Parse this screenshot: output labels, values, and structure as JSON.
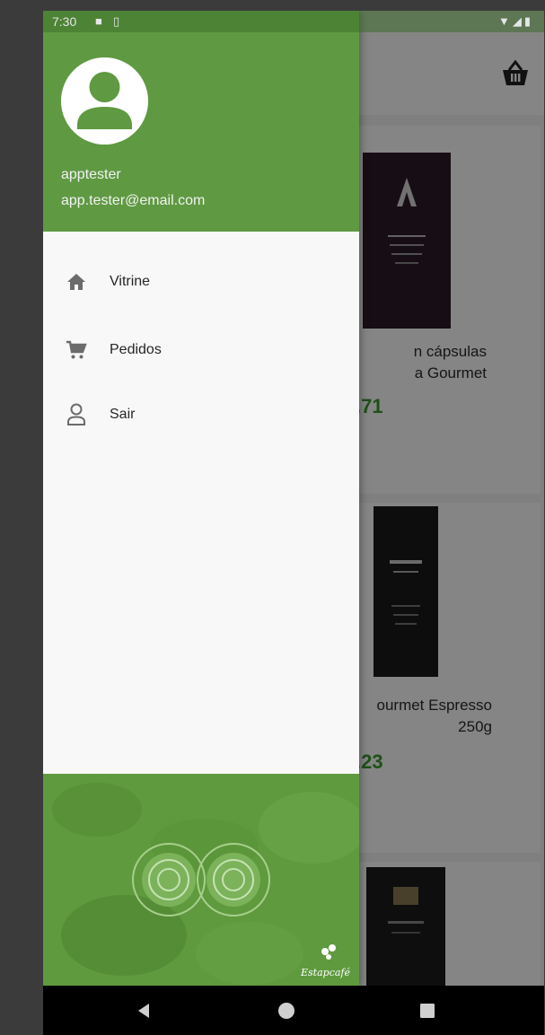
{
  "status_bar": {
    "time": "7:30",
    "icons": [
      "notification-icon",
      "sim-icon",
      "wifi-icon",
      "signal-icon",
      "battery-icon"
    ]
  },
  "drawer": {
    "header": {
      "username": "apptester",
      "email": "app.tester@email.com"
    },
    "menu": [
      {
        "label": "Vitrine",
        "icon": "home-icon"
      },
      {
        "label": "Pedidos",
        "icon": "cart-icon"
      },
      {
        "label": "Sair",
        "icon": "person-icon"
      }
    ],
    "footer": {
      "brand": "Estapcafé"
    }
  },
  "background": {
    "products": [
      {
        "name_line1": "n cápsulas",
        "name_line2": "a Gourmet",
        "price": ".71"
      },
      {
        "name_line1": "ourmet Espresso",
        "name_line2": "250g",
        "price": ".23"
      }
    ],
    "cart_icon": "basket-icon"
  },
  "colors": {
    "accent_green": "#5f9942",
    "price_green": "#3d9a2e"
  },
  "nav": {
    "icons": [
      "back-icon",
      "home-nav-icon",
      "recents-icon"
    ]
  }
}
